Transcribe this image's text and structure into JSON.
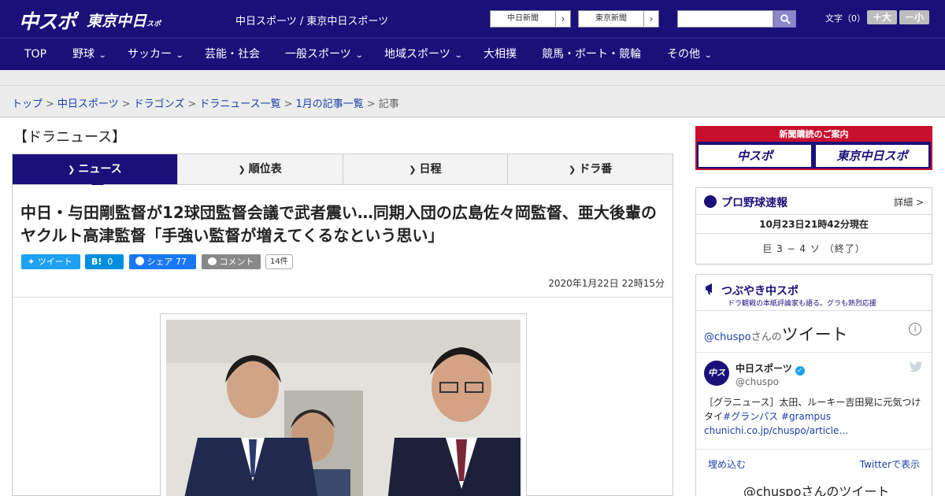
{
  "header": {
    "logo_main": "中スポ",
    "logo_tokyo": "東京中日",
    "logo_tokyo_small": "スポ",
    "site_title": "中日スポーツ / 東京中日スポーツ",
    "ext_links": [
      "中日新聞",
      "東京新聞"
    ],
    "search_placeholder": "",
    "font_size_label": "文字（0）",
    "font_larger": "＋大",
    "font_smaller": "－小"
  },
  "nav": {
    "items": [
      {
        "label": "TOP",
        "has_submenu": false
      },
      {
        "label": "野球",
        "has_submenu": true
      },
      {
        "label": "サッカー",
        "has_submenu": true
      },
      {
        "label": "芸能・社会",
        "has_submenu": false
      },
      {
        "label": "一般スポーツ",
        "has_submenu": true
      },
      {
        "label": "地域スポーツ",
        "has_submenu": true
      },
      {
        "label": "大相撲",
        "has_submenu": false
      },
      {
        "label": "競馬・ボート・競輪",
        "has_submenu": false
      },
      {
        "label": "その他",
        "has_submenu": true
      }
    ]
  },
  "breadcrumb": {
    "items": [
      "トップ",
      "中日スポーツ",
      "ドラゴンズ",
      "ドラニュース一覧",
      "1月の記事一覧"
    ],
    "current": "記事",
    "separator": ">"
  },
  "section": {
    "title": "【ドラニュース】"
  },
  "tabs": [
    {
      "label": "ニュース",
      "active": true
    },
    {
      "label": "順位表",
      "active": false
    },
    {
      "label": "日程",
      "active": false
    },
    {
      "label": "ドラ番",
      "active": false
    }
  ],
  "article": {
    "headline": "中日・与田剛監督が12球団監督会議で武者震い…同期入団の広島佐々岡監督、亜大後輩のヤクルト高津監督「手強い監督が増えてくるなという思い」",
    "share": {
      "tweet": "ツイート",
      "hatena_icon": "B!",
      "hatena_count": "0",
      "facebook": "シェア",
      "facebook_count": "77",
      "comment": "コメント",
      "comment_count": "14件"
    },
    "datetime": "2020年1月22日 22時15分"
  },
  "sidebar": {
    "ad_heading": "新聞購読のご案内",
    "ad_logos": [
      "中スポ",
      "東京中日スポ"
    ],
    "baseball": {
      "title": "プロ野球速報",
      "detail": "詳細 >",
      "as_of": "10月23日21時42分現在",
      "score_line": "巨 3 − 4 ソ （終了）"
    },
    "tsubuyaki": {
      "title": "つぶやき中スポ",
      "subtitle": "ドラ観戦の本紙評論家も語る。グラも熱烈応援"
    },
    "twitter": {
      "handle_prefix": "@chuspo",
      "handle_suffix": "さんの",
      "heading": "ツイート",
      "account_name": "中日スポーツ",
      "account_handle": "@chuspo",
      "avatar_text": "中スポ",
      "tweet_text_plain": "［グラニュース］太田、ルーキー吉田晃に元気つけ",
      "tweet_text_plain2": "タイ",
      "hashtag1": "#グランパス",
      "hashtag2": "#grampus",
      "link": "chunichi.co.jp/chuspo/article…",
      "embed": "埋め込む",
      "view_on": "Twitterで表示",
      "bottom_heading": "@chuspoさんのツイート"
    }
  },
  "colors": {
    "brand_navy": "#1b0f7a",
    "ad_red": "#c8102e",
    "link_blue": "#1b3ea8",
    "twitter_blue": "#1da1f2",
    "facebook_blue": "#1877f2"
  }
}
